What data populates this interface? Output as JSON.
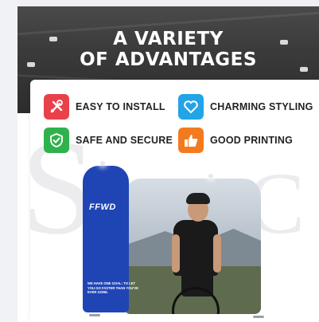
{
  "hero": {
    "title_line1": "A VARIETY",
    "title_line2": "OF ADVANTAGES"
  },
  "features": [
    {
      "label": "EASY TO INSTALL",
      "icon": "tools-icon",
      "color": "#e8414a"
    },
    {
      "label": "CHARMING STYLING",
      "icon": "heart-icon",
      "color": "#23a4e6"
    },
    {
      "label": "SAFE AND SECURE",
      "icon": "shield-check-icon",
      "color": "#2fb24c"
    },
    {
      "label": "GOOD PRINTING",
      "icon": "thumbs-up-icon",
      "color": "#f47a1f"
    }
  ],
  "product": {
    "brand": "FFWD",
    "slogan": "WE HAVE ONE GOAL: TO LET YOU GO FASTER THAN YOU'VE EVER GONE."
  }
}
